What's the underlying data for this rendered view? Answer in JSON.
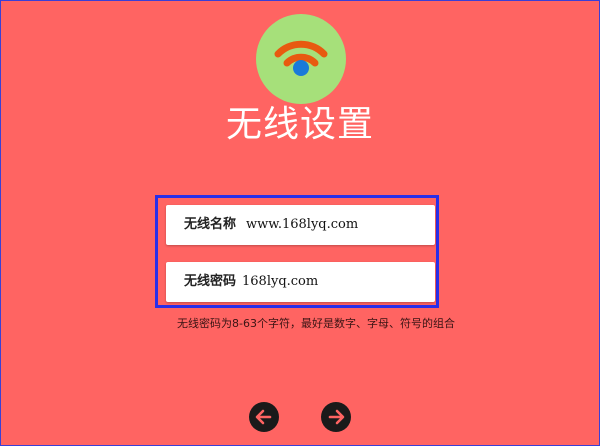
{
  "page": {
    "title": "无线设置"
  },
  "logo": {
    "icon": "wifi-icon",
    "bg_color": "#a6e07a",
    "signal_color": "#e85a10",
    "dot_color": "#1a7ad9"
  },
  "form": {
    "ssid": {
      "label": "无线名称",
      "value": "www.168lyq.com"
    },
    "password": {
      "label": "无线密码",
      "value": "168lyq.com"
    }
  },
  "hint": "无线密码为8-63个字符，最好是数字、字母、符号的组合",
  "nav": {
    "prev_icon": "arrow-left-icon",
    "next_icon": "arrow-right-icon"
  },
  "colors": {
    "background": "#ff6462",
    "highlight_border": "#2a2ee8"
  }
}
